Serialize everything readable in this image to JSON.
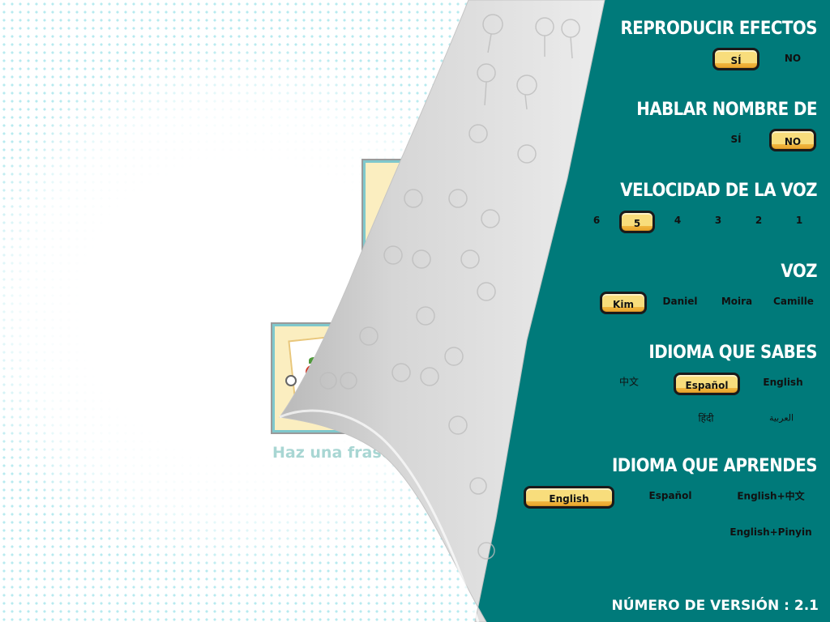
{
  "colors": {
    "panel_teal": "#007a7a",
    "button_yellow": "#f8dd7c",
    "button_border": "#1a1a1a",
    "title_white": "#ffffff",
    "home_label": "#a8d6d3"
  },
  "background": {
    "home_label": "Haz una frase"
  },
  "settings": {
    "sound_effects": {
      "title": "REPRODUCIR EFECTOS",
      "options": [
        "SÍ",
        "NO"
      ],
      "selected": "SÍ"
    },
    "speak_name": {
      "title": "HABLAR NOMBRE DE",
      "options": [
        "SÍ",
        "NO"
      ],
      "selected": "NO"
    },
    "voice_speed": {
      "title": "VELOCIDAD DE LA VOZ",
      "options": [
        "6",
        "5",
        "4",
        "3",
        "2",
        "1"
      ],
      "selected": "5"
    },
    "voice": {
      "title": "VOZ",
      "options": [
        "Kim",
        "Daniel",
        "Moira",
        "Camille"
      ],
      "selected": "Kim"
    },
    "known_language": {
      "title": "IDIOMA QUE SABES",
      "options": [
        "中文",
        "Español",
        "English",
        "हिंदी",
        "العربية"
      ],
      "selected": "Español"
    },
    "learning_language": {
      "title": "IDIOMA QUE APRENDES",
      "options": [
        "English",
        "Español",
        "English+中文",
        "English+Pinyin"
      ],
      "selected": "English"
    },
    "version": "NÚMERO DE VERSIÓN : 2.1"
  }
}
